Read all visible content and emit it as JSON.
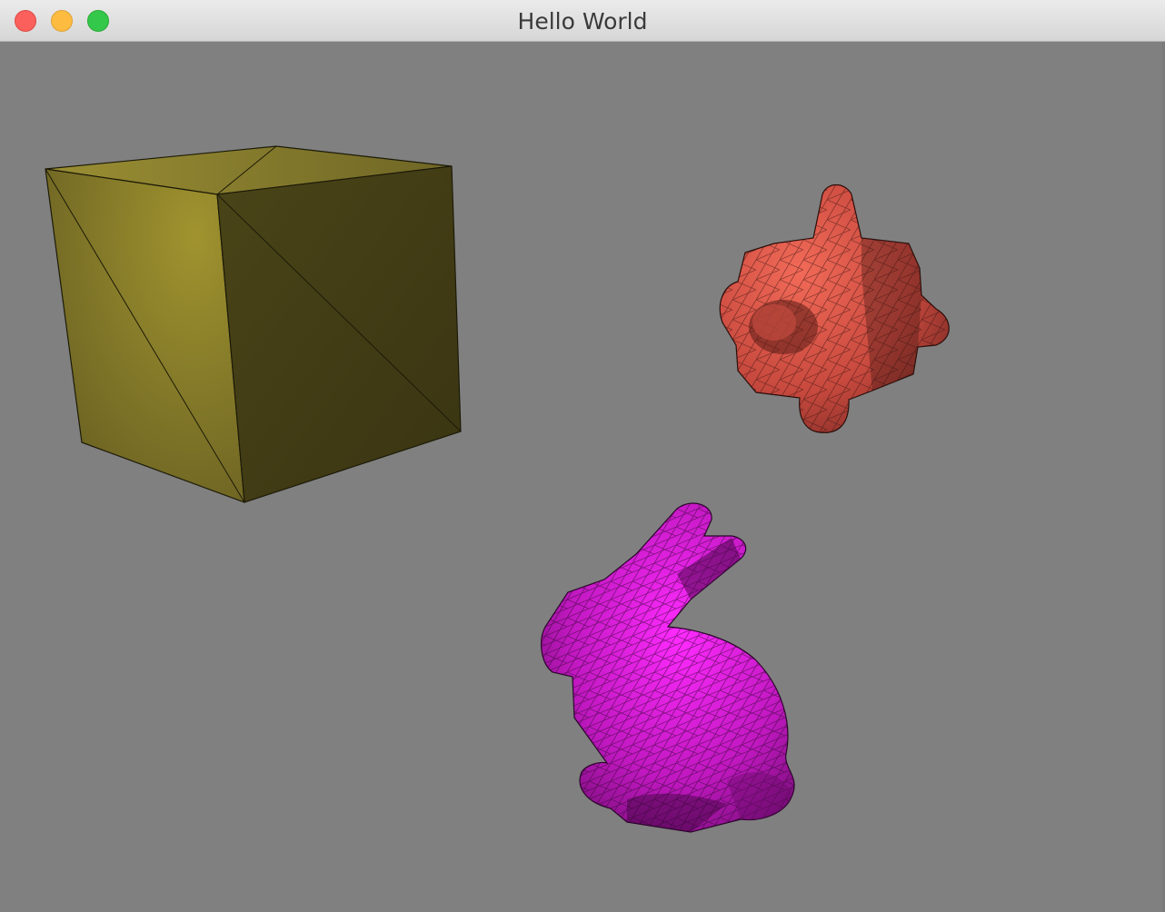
{
  "window": {
    "title": "Hello World",
    "controls": {
      "close_color": "#fc605c",
      "minimize_color": "#fdbc40",
      "zoom_color": "#34c84a"
    }
  },
  "scene": {
    "background_color": "#808080",
    "objects": [
      {
        "name": "cube",
        "color": "#8f8430"
      },
      {
        "name": "spiked-cube",
        "color": "#e0574a"
      },
      {
        "name": "bunny",
        "color": "#d61fd6"
      }
    ]
  }
}
